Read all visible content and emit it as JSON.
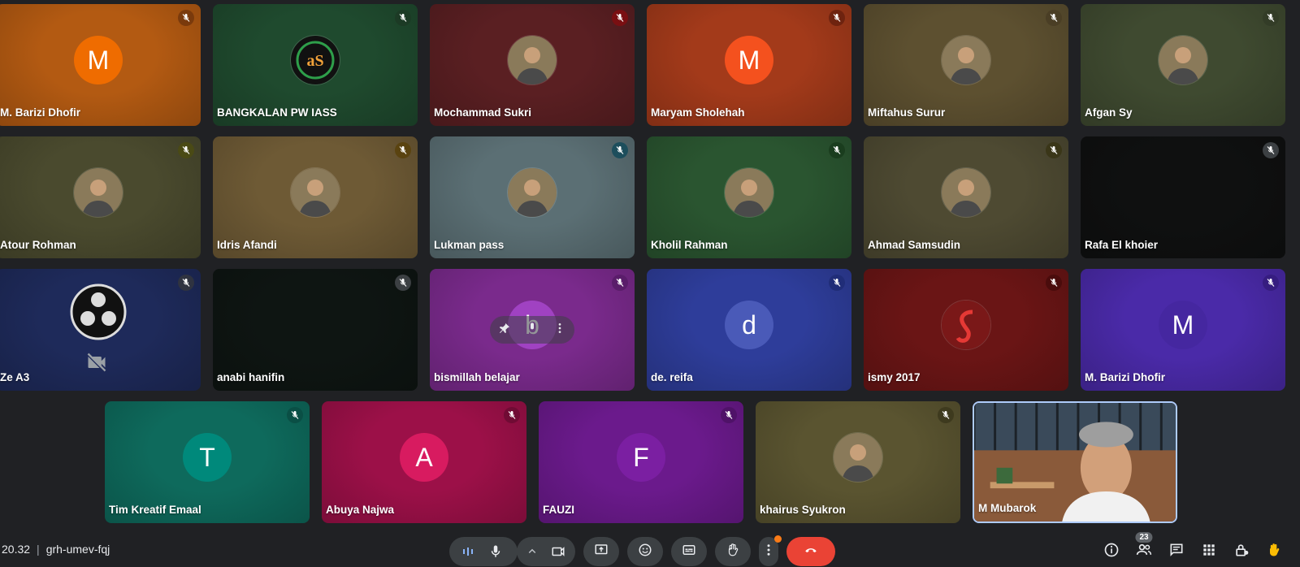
{
  "meeting": {
    "time": "20.32",
    "code": "grh-umev-fqj"
  },
  "participants": [
    {
      "name": "M. Barizi Dhofir",
      "avatar": {
        "type": "letter",
        "letter": "M",
        "color": "#ef6c00"
      },
      "bg": "#b35a12",
      "mute_color": "#7a3a0c"
    },
    {
      "name": "BANGKALAN PW IASS",
      "avatar": {
        "type": "photo",
        "icon": "iass-logo-icon"
      },
      "bg": "#1f4a2e",
      "mute_color": "#1c3a25"
    },
    {
      "name": "Mochammad Sukri",
      "avatar": {
        "type": "photo",
        "icon": "person-photo-icon"
      },
      "bg": "#5a1f22",
      "mute_color": "#7a0f12"
    },
    {
      "name": "Maryam Sholehah",
      "avatar": {
        "type": "letter",
        "letter": "M",
        "color": "#f4511e"
      },
      "bg": "#a33a1a",
      "mute_color": "#6e230f"
    },
    {
      "name": "Miftahus Surur",
      "avatar": {
        "type": "photo",
        "icon": "person-photo-icon"
      },
      "bg": "#5d5030",
      "mute_color": "#4a3e25"
    },
    {
      "name": "Afgan Sy",
      "avatar": {
        "type": "photo",
        "icon": "person-photo-icon"
      },
      "bg": "#3f4a30",
      "mute_color": "#333c27"
    },
    {
      "name": "Atour Rohman",
      "avatar": {
        "type": "photo",
        "icon": "person-photo-icon"
      },
      "bg": "#4a4a2e",
      "mute_color": "#4a4a15"
    },
    {
      "name": "Idris Afandi",
      "avatar": {
        "type": "photo",
        "icon": "person-photo-icon"
      },
      "bg": "#6e5a35",
      "mute_color": "#5a4310"
    },
    {
      "name": "Lukman pass",
      "avatar": {
        "type": "photo",
        "icon": "person-photo-icon"
      },
      "bg": "#5b6f74",
      "mute_color": "#1d4e5c"
    },
    {
      "name": "Kholil Rahman",
      "avatar": {
        "type": "photo",
        "icon": "person-photo-icon"
      },
      "bg": "#2a5530",
      "mute_color": "#1a3d1e"
    },
    {
      "name": "Ahmad Samsudin",
      "avatar": {
        "type": "photo",
        "icon": "person-photo-icon"
      },
      "bg": "#4e4a32",
      "mute_color": "#3a3618"
    },
    {
      "name": "Rafa El khoier",
      "avatar": {
        "type": "none"
      },
      "bg": "#0f1010",
      "mute_color": "#3c4043"
    },
    {
      "name": "Ze A3",
      "avatar": {
        "type": "photo",
        "icon": "obs-logo-icon"
      },
      "bg": "#1e2a5a",
      "mute_color": "#2f3340",
      "camera_off": true
    },
    {
      "name": "anabi hanifin",
      "avatar": {
        "type": "none"
      },
      "bg": "#0e1512",
      "mute_color": "#3c4043"
    },
    {
      "name": "bismillah belajar",
      "avatar": {
        "type": "letter",
        "letter": "b",
        "color": "#a042c2"
      },
      "bg": "#7a2a8c",
      "mute_color": "#5a1d6a",
      "hover_menu": true
    },
    {
      "name": "de. reifa",
      "avatar": {
        "type": "letter",
        "letter": "d",
        "color": "#4a5ab8"
      },
      "bg": "#2e3d9a",
      "mute_color": "#202d78"
    },
    {
      "name": "ismy 2017",
      "avatar": {
        "type": "photo",
        "icon": "snake-logo-icon"
      },
      "bg": "#6a1515",
      "mute_color": "#4a0c0c"
    },
    {
      "name": "M. Barizi Dhofir",
      "avatar": {
        "type": "letter",
        "letter": "M",
        "color": "#4527a0"
      },
      "bg": "#4a2aa8",
      "mute_color": "#361d80"
    },
    {
      "name": "Tim Kreatif Emaal",
      "avatar": {
        "type": "letter",
        "letter": "T",
        "color": "#00897b"
      },
      "bg": "#0e6a5c",
      "mute_color": "#0a4f45"
    },
    {
      "name": "Abuya Najwa",
      "avatar": {
        "type": "letter",
        "letter": "A",
        "color": "#d81b60"
      },
      "bg": "#9c1048",
      "mute_color": "#700b34"
    },
    {
      "name": "FAUZI",
      "avatar": {
        "type": "letter",
        "letter": "F",
        "color": "#7b1fa2"
      },
      "bg": "#6b1a8c",
      "mute_color": "#4f1268"
    },
    {
      "name": "khairus Syukron",
      "avatar": {
        "type": "photo",
        "icon": "person-photo-icon"
      },
      "bg": "#5a5430",
      "mute_color": "#3e3a1e"
    },
    {
      "name": "M Mubarok",
      "avatar": {
        "type": "video",
        "icon": "self-video-icon"
      },
      "bg": "#5a4a3a",
      "self": true
    }
  ],
  "controls": {
    "people_count": "23",
    "accent_red": "#ea4335",
    "hand_color": "#fbbc04"
  }
}
